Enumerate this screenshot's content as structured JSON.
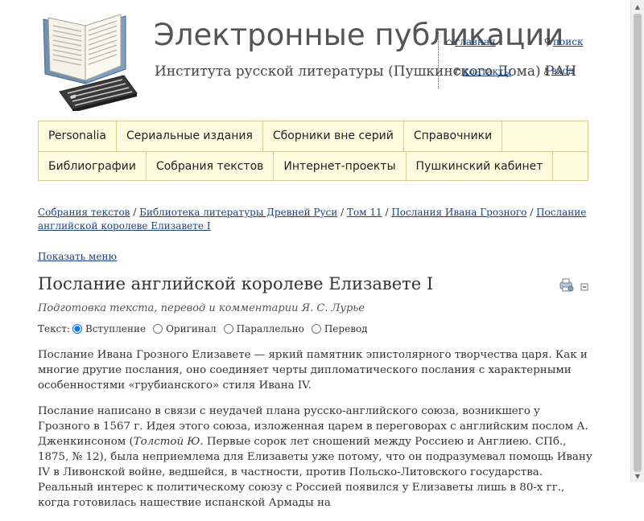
{
  "header": {
    "title": "Электронные публикации",
    "subtitle": "Института русской литературы (Пушкинского Дома) РАН",
    "links": {
      "home": "главная",
      "search": "поиск",
      "contacts": "контакты",
      "login": "вход"
    },
    "icons": {
      "home": "home-icon",
      "search": "search-icon",
      "contacts": "contacts-icon",
      "login": "key-icon"
    }
  },
  "nav": {
    "row1": [
      "Personalia",
      "Сериальные издания",
      "Сборники вне серий",
      "Справочники"
    ],
    "row2": [
      "Библиографии",
      "Собрания текстов",
      "Интернет-проекты",
      "Пушкинский кабинет"
    ]
  },
  "breadcrumb": {
    "items": [
      "Собрания текстов",
      "Библиотека литературы Древней Руси",
      "Том 11",
      "Послания Ивана Грозного",
      "Послание английской королеве Елизавете I"
    ],
    "separator": "/"
  },
  "show_menu": "Показать меню",
  "page": {
    "title": "Послание английской королеве Елизавете I",
    "credit": "Подготовка текста, перевод и комментарии Я. С. Лурье"
  },
  "text_selector": {
    "label": "Текст:",
    "options": [
      "Вступление",
      "Оригинал",
      "Параллельно",
      "Перевод"
    ],
    "selected": "Вступление"
  },
  "body": {
    "p1": "Послание Ивана Грозного Елизавете — яркий памятник эпистолярного творчества царя. Как и многие другие послания, оно соединяет черты дипломатического послания с характерными особенностями «грубианского» стиля Ивана IV.",
    "p2_a": "Послание написано в связи с неудачей плана русско-английского союза, возникшего у Грозного в 1567 г. Идея этого союза, изложенная царем в переговорах с английским послом А. Дженкинсоном (",
    "p2_cite_author": "Толстой Ю.",
    "p2_b": " Первые сорок лет сношений между Россиею и Англиею. СПб., 1875, № 12), была неприемлема для Елизаветы уже потому, что он подразумевал помощь Ивану IV в Ливонской войне, ведшейся, в частности, против Польско-Литовского государства. Реальный интерес к политическому союзу с Россией появился у Елизаветы лишь в 80-х гг., когда готовилась нашествие испанской Армады на"
  },
  "colors": {
    "link": "#1a3f8a",
    "nav_bg": "#fefbdf",
    "nav_border": "#d6cf95"
  }
}
